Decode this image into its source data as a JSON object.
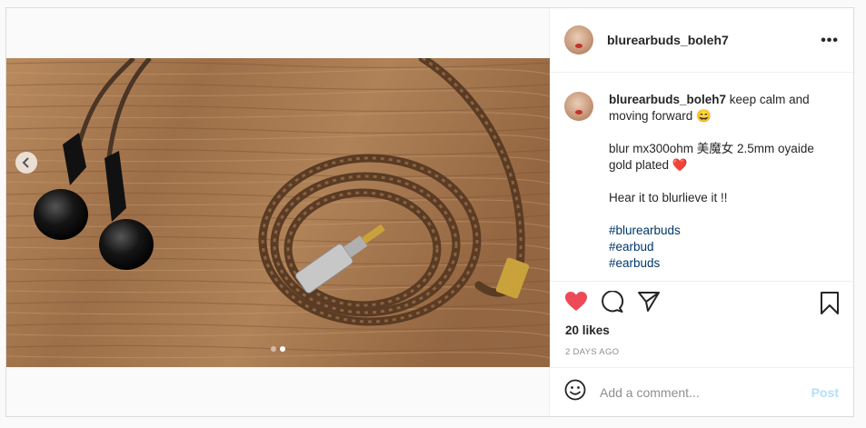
{
  "post": {
    "username": "blurearbuds_boleh7",
    "more_icon": "more-horizontal-icon"
  },
  "caption": {
    "username": "blurearbuds_boleh7",
    "line1": "keep calm and moving forward 😄",
    "line2": "blur mx300ohm 美魔女 2.5mm oyaide gold plated ❤️",
    "line3": "Hear it to blurlieve it !!",
    "tags": [
      "#blurearbuds",
      "#earbud",
      "#earbuds"
    ]
  },
  "actions": {
    "likes": "20 likes",
    "age": "2 DAYS AGO",
    "icons": [
      "heart-icon",
      "comment-icon",
      "share-icon",
      "bookmark-icon"
    ],
    "heart_color": "#ed4956"
  },
  "comment": {
    "placeholder": "Add a comment...",
    "post_label": "Post"
  },
  "carousel": {
    "slide_count": 2,
    "active_slide": 2
  }
}
